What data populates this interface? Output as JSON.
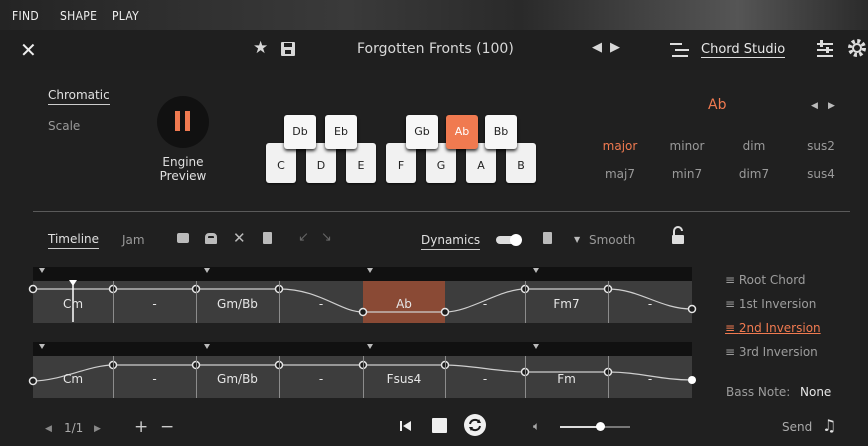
{
  "topmenu": {
    "items": [
      "FIND",
      "SHAPE",
      "PLAY"
    ]
  },
  "header": {
    "preset_name": "Forgotten Fronts (100)",
    "studio_label": "Chord Studio"
  },
  "mode": {
    "chromatic": "Chromatic",
    "scale": "Scale"
  },
  "engine": {
    "label_line1": "Engine",
    "label_line2": "Preview"
  },
  "keyboard": {
    "white_keys": [
      "C",
      "D",
      "E",
      "F",
      "G",
      "A",
      "B"
    ],
    "black_keys": [
      "Db",
      "Eb",
      "Gb",
      "Ab",
      "Bb"
    ],
    "active_key": "Ab"
  },
  "chord": {
    "root": "Ab",
    "types_row1": [
      "major",
      "minor",
      "dim",
      "sus2"
    ],
    "types_row2": [
      "maj7",
      "min7",
      "dim7",
      "sus4"
    ],
    "active_type": "major"
  },
  "toolbar": {
    "timeline": "Timeline",
    "jam": "Jam",
    "dynamics": "Dynamics",
    "smooth": "Smooth"
  },
  "lane1": {
    "chords": [
      "Cm",
      "-",
      "Gm/Bb",
      "-",
      "Ab",
      "-",
      "Fm7",
      "-"
    ],
    "active_chord": "Ab"
  },
  "lane2": {
    "chords": [
      "Cm",
      "-",
      "Gm/Bb",
      "-",
      "Fsus4",
      "-",
      "Fm",
      "-"
    ]
  },
  "inversions": {
    "items": [
      "Root Chord",
      "1st Inversion",
      "2nd Inversion",
      "3rd Inversion"
    ],
    "active": "2nd Inversion",
    "bass_label": "Bass Note:",
    "bass_value": "None"
  },
  "footer": {
    "page": "1/1",
    "send": "Send"
  },
  "colors": {
    "accent": "#f07a50",
    "lane": "#3d3d3d",
    "background": "#202020"
  }
}
